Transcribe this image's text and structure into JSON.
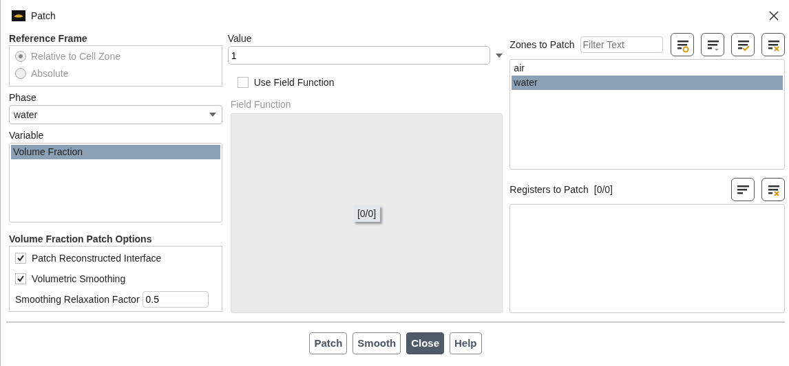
{
  "window": {
    "title": "Patch"
  },
  "reference_frame": {
    "label": "Reference Frame",
    "options": [
      {
        "label": "Relative to Cell Zone",
        "selected": true
      },
      {
        "label": "Absolute",
        "selected": false
      }
    ],
    "disabled": true
  },
  "phase": {
    "label": "Phase",
    "value": "water"
  },
  "variable": {
    "label": "Variable",
    "items": [
      {
        "label": "Volume Fraction",
        "selected": true
      }
    ]
  },
  "vf_options": {
    "label": "Volume Fraction Patch Options",
    "checks": [
      {
        "label": "Patch Reconstructed Interface",
        "checked": true
      },
      {
        "label": "Volumetric Smoothing",
        "checked": true
      }
    ],
    "factor": {
      "label": "Smoothing Relaxation Factor",
      "value": "0.5"
    }
  },
  "value": {
    "label": "Value",
    "value": "1"
  },
  "use_field_function": {
    "label": "Use Field Function",
    "checked": false
  },
  "field_function": {
    "label": "Field Function",
    "disabled": true,
    "count": "[0/0]"
  },
  "zones": {
    "label": "Zones to Patch",
    "filter_placeholder": "Filter Text",
    "items": [
      {
        "label": "air",
        "selected": false
      },
      {
        "label": "water",
        "selected": true
      }
    ]
  },
  "registers": {
    "label": "Registers to Patch",
    "count": "[0/0]"
  },
  "buttons": [
    {
      "label": "Patch",
      "primary": false
    },
    {
      "label": "Smooth",
      "primary": false
    },
    {
      "label": "Close",
      "primary": true
    },
    {
      "label": "Help",
      "primary": false
    }
  ]
}
